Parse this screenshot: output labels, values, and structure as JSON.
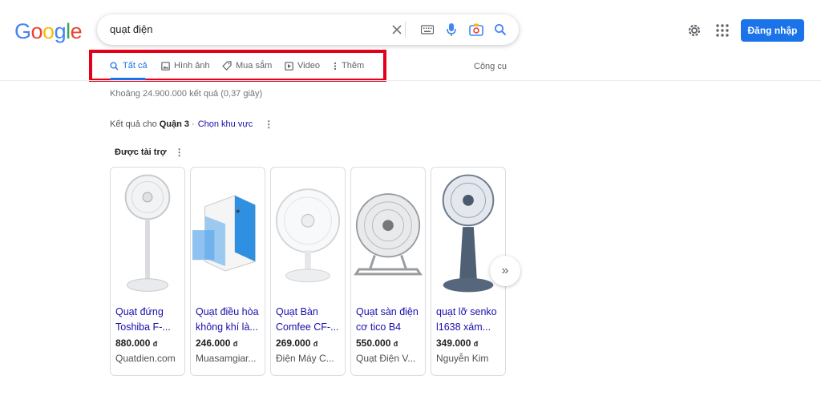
{
  "logo": {
    "letters": [
      "G",
      "o",
      "o",
      "g",
      "l",
      "e"
    ],
    "colors": [
      "#4285f4",
      "#ea4335",
      "#fbbc05",
      "#4285f4",
      "#34a853",
      "#ea4335"
    ]
  },
  "search": {
    "query": "quạt điện"
  },
  "header": {
    "signin_label": "Đăng nhập"
  },
  "tabs": [
    {
      "label": "Tất cả",
      "icon": "search-icon",
      "active": true
    },
    {
      "label": "Hình ảnh",
      "icon": "image-icon",
      "active": false
    },
    {
      "label": "Mua sắm",
      "icon": "tag-icon",
      "active": false
    },
    {
      "label": "Video",
      "icon": "play-icon",
      "active": false
    },
    {
      "label": "Thêm",
      "icon": "more-vert-icon",
      "active": false
    }
  ],
  "tools_label": "Công cụ",
  "stats": "Khoảng 24.900.000 kết quả (0,37 giây)",
  "location": {
    "prefix": "Kết quả cho",
    "place": "Quận 3",
    "separator": "·",
    "link": "Chọn khu vực"
  },
  "sponsored_label": "Được tài trợ",
  "products": [
    {
      "title_line1": "Quạt đứng",
      "title_line2": "Toshiba F-...",
      "price": "880.000",
      "currency": "đ",
      "store": "Quatdien.com"
    },
    {
      "title_line1": "Quạt điều hòa",
      "title_line2": "không khí là...",
      "price": "246.000",
      "currency": "đ",
      "store": "Muasamgiar..."
    },
    {
      "title_line1": "Quạt Bàn",
      "title_line2": "Comfee CF-...",
      "price": "269.000",
      "currency": "đ",
      "store": "Điện Máy C..."
    },
    {
      "title_line1": "Quạt sàn điện",
      "title_line2": "cơ tico B4",
      "price": "550.000",
      "currency": "đ",
      "store": "Quạt Điện V..."
    },
    {
      "title_line1": "quạt lỡ senko",
      "title_line2": "l1638 xám...",
      "price": "349.000",
      "currency": "đ",
      "store": "Nguyễn Kim"
    }
  ],
  "colors": {
    "accent": "#1a73e8",
    "link": "#1a0dab",
    "highlight": "#e3001b"
  }
}
